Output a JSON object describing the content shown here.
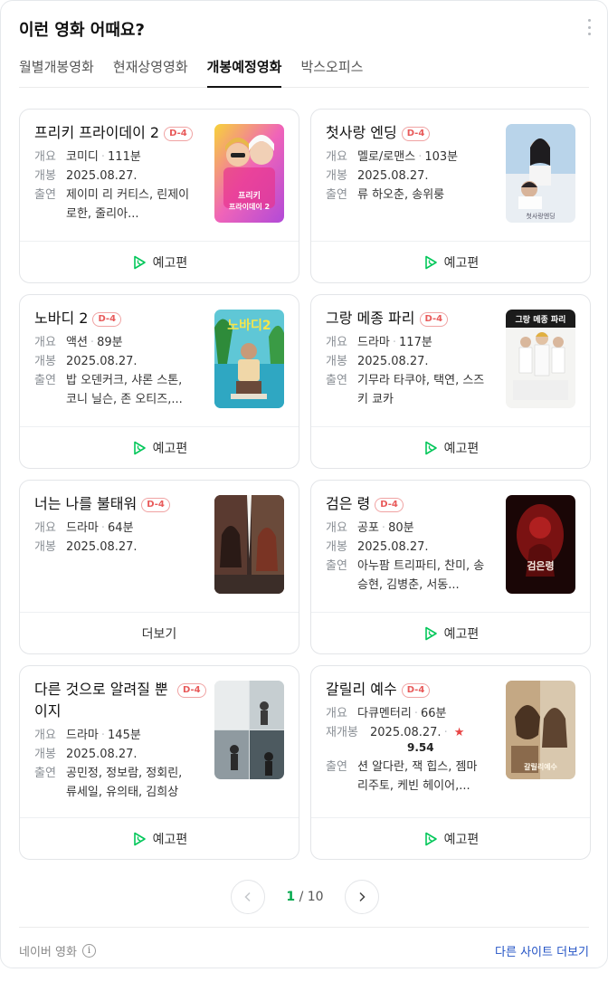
{
  "header": {
    "title": "이런 영화 어때요?"
  },
  "tabs": [
    {
      "label": "월별개봉영화",
      "active": false
    },
    {
      "label": "현재상영영화",
      "active": false
    },
    {
      "label": "개봉예정영화",
      "active": true
    },
    {
      "label": "박스오피스",
      "active": false
    }
  ],
  "labels": {
    "genre": "개요",
    "release": "개봉",
    "rerelease": "재개봉",
    "cast": "출연",
    "trailer": "예고편",
    "more": "더보기"
  },
  "movies": [
    {
      "title": "프리키 프라이데이 2",
      "badge": "D-4",
      "genre": "코미디",
      "runtime": "111분",
      "date": "2025.08.27.",
      "cast": "제이미 리 커티스, 린제이 로한, 줄리아...",
      "action": "예고편",
      "poster_text": "프리키 프라이데이 2"
    },
    {
      "title": "첫사랑 엔딩",
      "badge": "D-4",
      "genre": "멜로/로맨스",
      "runtime": "103분",
      "date": "2025.08.27.",
      "cast": "류 하오춘, 송위룽",
      "action": "예고편",
      "poster_text": "첫사랑엔딩"
    },
    {
      "title": "노바디 2",
      "badge": "D-4",
      "genre": "액션",
      "runtime": "89분",
      "date": "2025.08.27.",
      "cast": "밥 오덴커크, 샤론 스톤, 코니 닐슨, 존 오티즈,...",
      "action": "예고편",
      "poster_text": "노바디2"
    },
    {
      "title": "그랑 메종 파리",
      "badge": "D-4",
      "genre": "드라마",
      "runtime": "117분",
      "date": "2025.08.27.",
      "cast": "기무라 타쿠야, 택연, 스즈키 쿄카",
      "action": "예고편",
      "poster_text": "그랑 메종 파리"
    },
    {
      "title": "너는 나를 불태워",
      "badge": "D-4",
      "genre": "드라마",
      "runtime": "64분",
      "date": "2025.08.27.",
      "cast": "",
      "action": "더보기",
      "poster_text": ""
    },
    {
      "title": "검은 령",
      "badge": "D-4",
      "genre": "공포",
      "runtime": "80분",
      "date": "2025.08.27.",
      "cast": "아누팜 트리파티, 찬미, 송승현, 김병춘, 서동...",
      "action": "예고편",
      "poster_text": "검은령"
    },
    {
      "title": "다른 것으로 알려질 뿐이지",
      "badge": "D-4",
      "genre": "드라마",
      "runtime": "145분",
      "date": "2025.08.27.",
      "cast": "공민정, 정보람, 정회린, 류세일, 유의태, 김희상",
      "action": "예고편",
      "poster_text": ""
    },
    {
      "title": "갈릴리 예수",
      "badge": "D-4",
      "genre": "다큐멘터리",
      "runtime": "66분",
      "date": "2025.08.27.",
      "rating": "9.54",
      "cast": "션 알다란, 잭 힙스, 젬마 리주토, 케빈 헤이어,...",
      "action": "예고편",
      "poster_text": "갈릴리예수"
    }
  ],
  "pagination": {
    "current": "1",
    "separator": "/",
    "total": "10"
  },
  "footer": {
    "source": "네이버 영화",
    "more_sites": "다른 사이트 더보기"
  },
  "icons": {
    "more": "more-vertical-icon",
    "play": "play-icon",
    "info": "info-icon",
    "prev": "chevron-left-icon",
    "next": "chevron-right-icon"
  },
  "colors": {
    "badge": "#e85a5a",
    "play": "#03c75a",
    "page_current": "#03a94d",
    "link": "#2454c6"
  }
}
